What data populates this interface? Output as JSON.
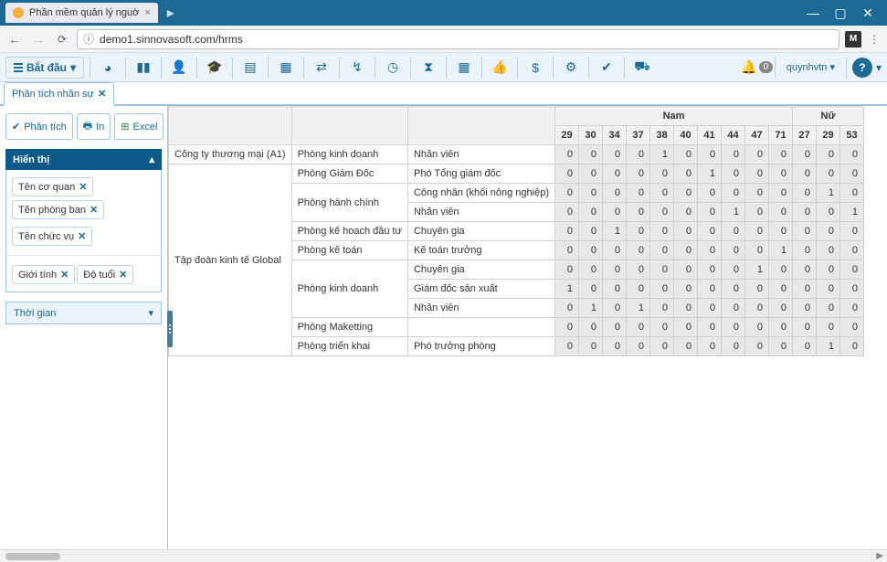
{
  "browser": {
    "tab_title": "Phần mềm quản lý nguờ",
    "url_host": "demo1.sinnovasoft.com/hrms",
    "ext_badge": "M"
  },
  "toolbar": {
    "start_label": "Bắt đầu",
    "notif_count": "0",
    "username": "quynhvtn"
  },
  "tabs": {
    "active": "Phân tích nhân sự"
  },
  "actions": {
    "analyze": "Phân tích",
    "print": "In",
    "excel": "Excel"
  },
  "panels": {
    "display_title": "Hiển thị",
    "chips1": [
      "Tên cơ quan",
      "Tên phòng ban"
    ],
    "chips2": [
      "Tên chức vụ"
    ],
    "chips3": [
      "Giới tính",
      "Độ tuổi"
    ],
    "time_title": "Thời gian"
  },
  "table": {
    "group_headers": [
      "Nam",
      "Nữ"
    ],
    "age_headers": [
      "29",
      "30",
      "34",
      "37",
      "38",
      "40",
      "41",
      "44",
      "47",
      "71",
      "27",
      "29",
      "53"
    ],
    "rows": [
      {
        "org": "Công ty thương mại (A1)",
        "dept": "Phòng kinh doanh",
        "title": "Nhân viên",
        "vals": [
          0,
          0,
          0,
          0,
          1,
          0,
          0,
          0,
          0,
          0,
          0,
          0,
          0
        ]
      },
      {
        "org": "Tập đoàn kinh tế Global",
        "dept": "Phòng Giám Đốc",
        "title": "Phó Tổng giám đốc",
        "vals": [
          0,
          0,
          0,
          0,
          0,
          0,
          1,
          0,
          0,
          0,
          0,
          0,
          0
        ]
      },
      {
        "org": "",
        "dept": "Phòng hành chính",
        "title": "Công nhân (khối nông nghiệp)",
        "vals": [
          0,
          0,
          0,
          0,
          0,
          0,
          0,
          0,
          0,
          0,
          0,
          1,
          0,
          0
        ]
      },
      {
        "org": "",
        "dept": "",
        "title": "Nhân viên",
        "vals": [
          0,
          0,
          0,
          0,
          0,
          0,
          0,
          1,
          0,
          0,
          0,
          0,
          1
        ]
      },
      {
        "org": "",
        "dept": "Phòng kế hoạch đầu tư",
        "title": "Chuyên gia",
        "vals": [
          0,
          0,
          1,
          0,
          0,
          0,
          0,
          0,
          0,
          0,
          0,
          0,
          0
        ]
      },
      {
        "org": "",
        "dept": "Phòng kế toán",
        "title": "Kế toán trưởng",
        "vals": [
          0,
          0,
          0,
          0,
          0,
          0,
          0,
          0,
          0,
          1,
          0,
          0,
          0
        ]
      },
      {
        "org": "",
        "dept": "Phòng kinh doanh",
        "title": "Chuyên gia",
        "vals": [
          0,
          0,
          0,
          0,
          0,
          0,
          0,
          0,
          1,
          0,
          0,
          0,
          0
        ]
      },
      {
        "org": "",
        "dept": "",
        "title": "Giám đốc sản xuất",
        "vals": [
          1,
          0,
          0,
          0,
          0,
          0,
          0,
          0,
          0,
          0,
          0,
          0,
          0
        ]
      },
      {
        "org": "",
        "dept": "",
        "title": "Nhân viên",
        "vals": [
          0,
          1,
          0,
          1,
          0,
          0,
          0,
          0,
          0,
          0,
          0,
          0,
          0
        ]
      },
      {
        "org": "",
        "dept": "Phòng Maketting",
        "title": "",
        "vals": [
          0,
          0,
          0,
          0,
          0,
          0,
          0,
          0,
          0,
          0,
          0,
          0,
          0
        ]
      },
      {
        "org": "",
        "dept": "Phòng triển khai",
        "title": "Phó trưởng phòng",
        "vals": [
          0,
          0,
          0,
          0,
          0,
          0,
          0,
          0,
          0,
          0,
          0,
          1,
          0
        ]
      }
    ],
    "org_rowspan1": 1,
    "org_rowspan2": 10,
    "dept_spans": {
      "1": 1,
      "2": 1,
      "3": 2,
      "5": 1,
      "6": 1,
      "7": 3,
      "10": 1,
      "11": 1
    }
  }
}
